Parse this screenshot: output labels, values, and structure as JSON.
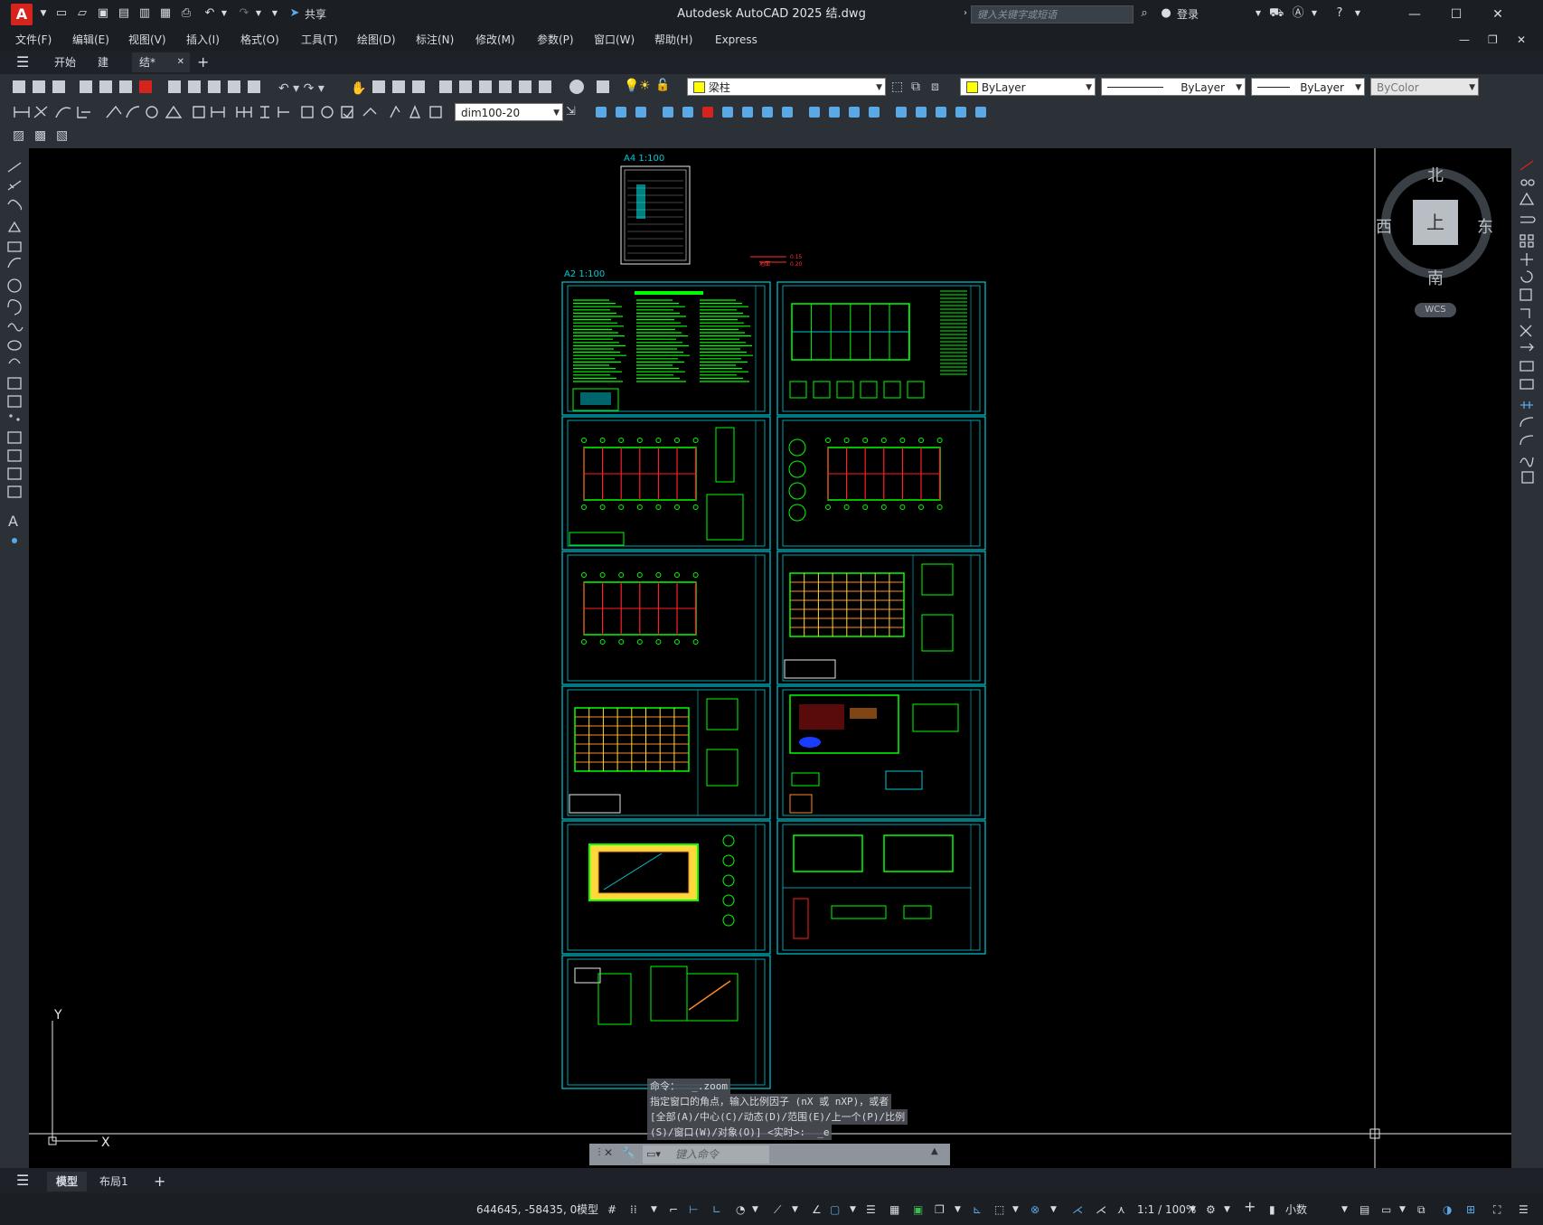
{
  "window": {
    "title": "Autodesk AutoCAD 2025    结.dwg",
    "search_placeholder": "键入关键字或短语",
    "share_label": "共享",
    "login_label": "登录",
    "app_logo": "A",
    "minimize_icon": "minimize-icon",
    "maximize_icon": "maximize-icon",
    "close_icon": "close-icon"
  },
  "menu": [
    "文件(F)",
    "编辑(E)",
    "视图(V)",
    "插入(I)",
    "格式(O)",
    "工具(T)",
    "绘图(D)",
    "标注(N)",
    "修改(M)",
    "参数(P)",
    "窗口(W)",
    "帮助(H)",
    "Express"
  ],
  "tabs": {
    "start": "开始",
    "tab1": "建",
    "tab2": "结*",
    "add": "+"
  },
  "toolbar": {
    "layer_name": "梁柱",
    "color": "ByLayer",
    "linetype": "ByLayer",
    "lineweight": "ByLayer",
    "plotstyle": "ByColor",
    "dimstyle": "dim100-20",
    "layer_color": "#ffff00"
  },
  "drawing": {
    "a4_label": "A4  1:100",
    "a2_label": "A2  1:100",
    "legend_top": "0.15",
    "legend_bottom": "0.20",
    "legend_label": "地面"
  },
  "viewcube": {
    "north": "北",
    "south": "南",
    "east": "东",
    "west": "西",
    "top": "上",
    "wcs": "WCS"
  },
  "ucs": {
    "x": "X",
    "y": "Y"
  },
  "command": {
    "line1": "命令：  _.zoom",
    "line2": "指定窗口的角点，输入比例因子 (nX 或 nXP)，或者",
    "line3": "[全部(A)/中心(C)/动态(D)/范围(E)/上一个(P)/比例",
    "line4": "(S)/窗口(W)/对象(O)] <实时>:  _e",
    "placeholder": "键入命令"
  },
  "layouts": {
    "model": "模型",
    "layout1": "布局1",
    "add": "+"
  },
  "status": {
    "coords": "644645, -58435, 0",
    "mode": "模型",
    "scale": "1:1 / 100%",
    "units": "小数"
  },
  "colors": {
    "sheet_border": "#00c8d7",
    "drawing_green": "#00ff00",
    "accent_red": "#d7231e"
  }
}
